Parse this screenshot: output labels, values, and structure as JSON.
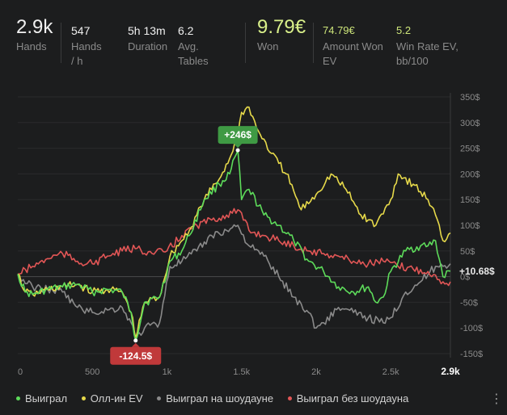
{
  "stats": [
    {
      "value": "2.9k",
      "label": "Hands"
    },
    {
      "value": "547",
      "label": "Hands / h"
    },
    {
      "value": "5h 13m",
      "label": "Duration"
    },
    {
      "value": "6.2",
      "label": "Avg. Tables"
    },
    {
      "value": "9.79€",
      "label": "Won"
    },
    {
      "value": "74.79€",
      "label": "Amount Won EV"
    },
    {
      "value": "5.2",
      "label": "Win Rate EV, bb/100"
    }
  ],
  "chart_data": {
    "type": "line",
    "x_ticks": [
      "0",
      "500",
      "1k",
      "1.5k",
      "2k",
      "2.5k",
      "2.9k"
    ],
    "x_tick_values": [
      0,
      500,
      1000,
      1500,
      2000,
      2500,
      2900
    ],
    "y_ticks": [
      "350$",
      "300$",
      "250$",
      "200$",
      "150$",
      "100$",
      "50$",
      "0$",
      "-50$",
      "-100$",
      "-150$"
    ],
    "y_tick_values": [
      350,
      300,
      250,
      200,
      150,
      100,
      50,
      0,
      -50,
      -100,
      -150
    ],
    "xlim": [
      0,
      2900
    ],
    "ylim": [
      -150,
      350
    ],
    "grid": true,
    "legend_position": "bottom-left",
    "annotations": [
      {
        "text": "+246$",
        "x": 1475,
        "y": 246,
        "color": "#3f9a44"
      },
      {
        "text": "-124.5$",
        "x": 790,
        "y": -124.5,
        "color": "#c0393a"
      },
      {
        "text": "+10.68$",
        "x": 2900,
        "y": 10.68,
        "color": "#e8e8e8"
      }
    ],
    "series": [
      {
        "name": "Выиграл",
        "color": "#5ddb5a",
        "x": [
          0,
          50,
          100,
          200,
          300,
          400,
          500,
          600,
          700,
          760,
          790,
          850,
          950,
          1020,
          1100,
          1150,
          1250,
          1350,
          1420,
          1475,
          1500,
          1550,
          1650,
          1750,
          1850,
          1950,
          2050,
          2150,
          2250,
          2350,
          2400,
          2450,
          2500,
          2600,
          2700,
          2750,
          2800,
          2850,
          2900
        ],
        "y": [
          5,
          -30,
          -35,
          -25,
          -20,
          -15,
          -30,
          -25,
          -30,
          -70,
          -124.5,
          -50,
          -40,
          30,
          50,
          80,
          150,
          180,
          200,
          246,
          150,
          170,
          120,
          100,
          70,
          30,
          10,
          -20,
          -30,
          -20,
          -50,
          -40,
          10,
          50,
          60,
          60,
          70,
          0,
          10.68
        ]
      },
      {
        "name": "Олл-ин EV",
        "color": "#e6d94a",
        "x": [
          0,
          50,
          100,
          200,
          300,
          400,
          500,
          600,
          700,
          760,
          790,
          850,
          950,
          1020,
          1100,
          1150,
          1250,
          1350,
          1420,
          1475,
          1500,
          1550,
          1600,
          1700,
          1800,
          1900,
          2000,
          2100,
          2200,
          2300,
          2400,
          2500,
          2550,
          2650,
          2750,
          2800,
          2850,
          2900
        ],
        "y": [
          5,
          -30,
          -35,
          -25,
          -20,
          -15,
          -30,
          -25,
          -30,
          -70,
          -120,
          -50,
          -40,
          40,
          70,
          90,
          150,
          190,
          230,
          275,
          320,
          330,
          290,
          240,
          200,
          130,
          160,
          200,
          170,
          120,
          100,
          150,
          200,
          180,
          150,
          120,
          70,
          85
        ]
      },
      {
        "name": "Выиграл на шоудауне",
        "color": "#8a8a8a",
        "x": [
          0,
          100,
          200,
          300,
          400,
          500,
          600,
          700,
          760,
          790,
          850,
          950,
          1020,
          1100,
          1200,
          1300,
          1400,
          1475,
          1550,
          1650,
          1750,
          1850,
          1950,
          2000,
          2050,
          2150,
          2250,
          2350,
          2450,
          2500,
          2600,
          2700,
          2800,
          2850,
          2900
        ],
        "y": [
          0,
          -20,
          -25,
          -30,
          -60,
          -70,
          -65,
          -60,
          -90,
          -120,
          -100,
          -90,
          20,
          30,
          50,
          80,
          90,
          100,
          60,
          40,
          0,
          -40,
          -70,
          -100,
          -90,
          -60,
          -70,
          -80,
          -90,
          -80,
          -30,
          -10,
          20,
          20,
          25
        ]
      },
      {
        "name": "Выиграл без шоудауна",
        "color": "#e25656",
        "x": [
          0,
          100,
          200,
          300,
          400,
          500,
          600,
          700,
          800,
          900,
          1000,
          1100,
          1200,
          1300,
          1400,
          1475,
          1550,
          1650,
          1750,
          1850,
          1950,
          2050,
          2150,
          2250,
          2350,
          2450,
          2550,
          2650,
          2750,
          2850,
          2900
        ],
        "y": [
          5,
          20,
          35,
          45,
          30,
          25,
          40,
          50,
          55,
          45,
          50,
          80,
          100,
          110,
          120,
          130,
          90,
          80,
          70,
          60,
          50,
          45,
          40,
          30,
          25,
          30,
          20,
          15,
          10,
          -10,
          -10
        ]
      }
    ]
  }
}
